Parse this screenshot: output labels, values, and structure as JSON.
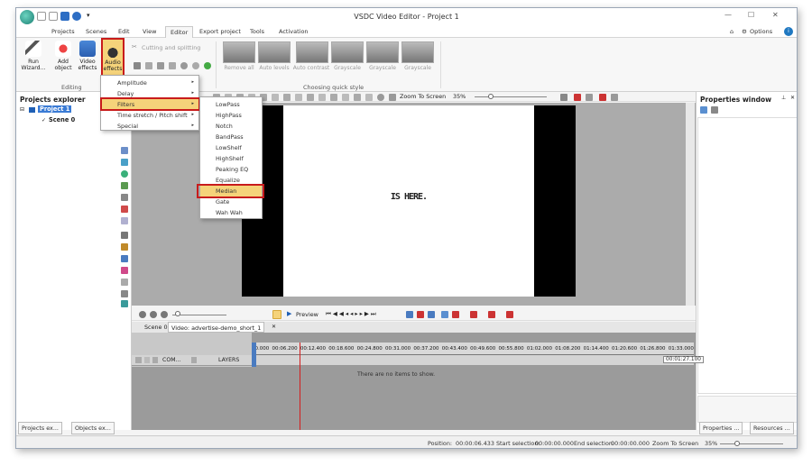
{
  "window": {
    "title": "VSDC Video Editor - Project 1"
  },
  "menu": {
    "items": [
      "Projects",
      "Scenes",
      "Edit",
      "View",
      "Editor",
      "Export project",
      "Tools",
      "Activation"
    ],
    "active": "Editor",
    "options_label": "Options"
  },
  "ribbon": {
    "run_wizard": "Run Wizard...",
    "add_object": "Add object",
    "video_effects": "Video effects",
    "audio_effects": "Audio effects",
    "cutting": "Cutting and splitting",
    "editing_label": "Editing",
    "quick_style_label": "Choosing quick style",
    "styles": [
      "Remove all",
      "Auto levels",
      "Auto contrast",
      "Grayscale",
      "Grayscale",
      "Grayscale"
    ]
  },
  "projects_explorer": {
    "title": "Projects explorer",
    "project": "Project 1",
    "scene": "Scene 0"
  },
  "audio_menu": {
    "items": [
      "Amplitude",
      "Delay",
      "Filters",
      "Time stretch / Pitch shift",
      "Special"
    ],
    "highlighted": "Filters"
  },
  "filters_menu": {
    "items": [
      "LowPass",
      "HighPass",
      "Notch",
      "BandPass",
      "LowShelf",
      "HighShelf",
      "Peaking EQ",
      "Equalize",
      "Median",
      "Gate",
      "Wah Wah"
    ],
    "highlighted": "Median"
  },
  "preview": {
    "zoom_label": "Zoom To Screen",
    "zoom_value": "35%",
    "caption": "IS HERE."
  },
  "properties": {
    "title": "Properties window"
  },
  "timeline": {
    "preview_label": "Preview",
    "tabs": [
      "Scene 0",
      "Video: advertise-demo_short_1"
    ],
    "ticks": [
      "00.000",
      "00:06.200",
      "00:12.400",
      "00:18.600",
      "00:24.800",
      "00:31.000",
      "00:37.200",
      "00:43.400",
      "00:49.600",
      "00:55.800",
      "01:02.000",
      "01:08.200",
      "01:14.400",
      "01:20.600",
      "01:26.800",
      "01:33.000"
    ],
    "com_label": "COM...",
    "layers_label": "LAYERS",
    "empty_message": "There are no items to show.",
    "end_time": "00:01:27.100"
  },
  "bottom_tabs": {
    "left": [
      "Projects ex...",
      "Objects ex..."
    ],
    "right": [
      "Properties ...",
      "Resources ..."
    ]
  },
  "status": {
    "position_label": "Position:",
    "position": "00:00:06.433",
    "start_label": "Start selection:",
    "start": "00:00:00.000",
    "end_label": "End selection:",
    "end": "00:00:00.000",
    "zoom_label": "Zoom To Screen",
    "zoom": "35%"
  },
  "colors": {
    "accent": "#0078d7",
    "highlight_red": "#c81b1b",
    "menu_highlight": "#f5d37a"
  }
}
